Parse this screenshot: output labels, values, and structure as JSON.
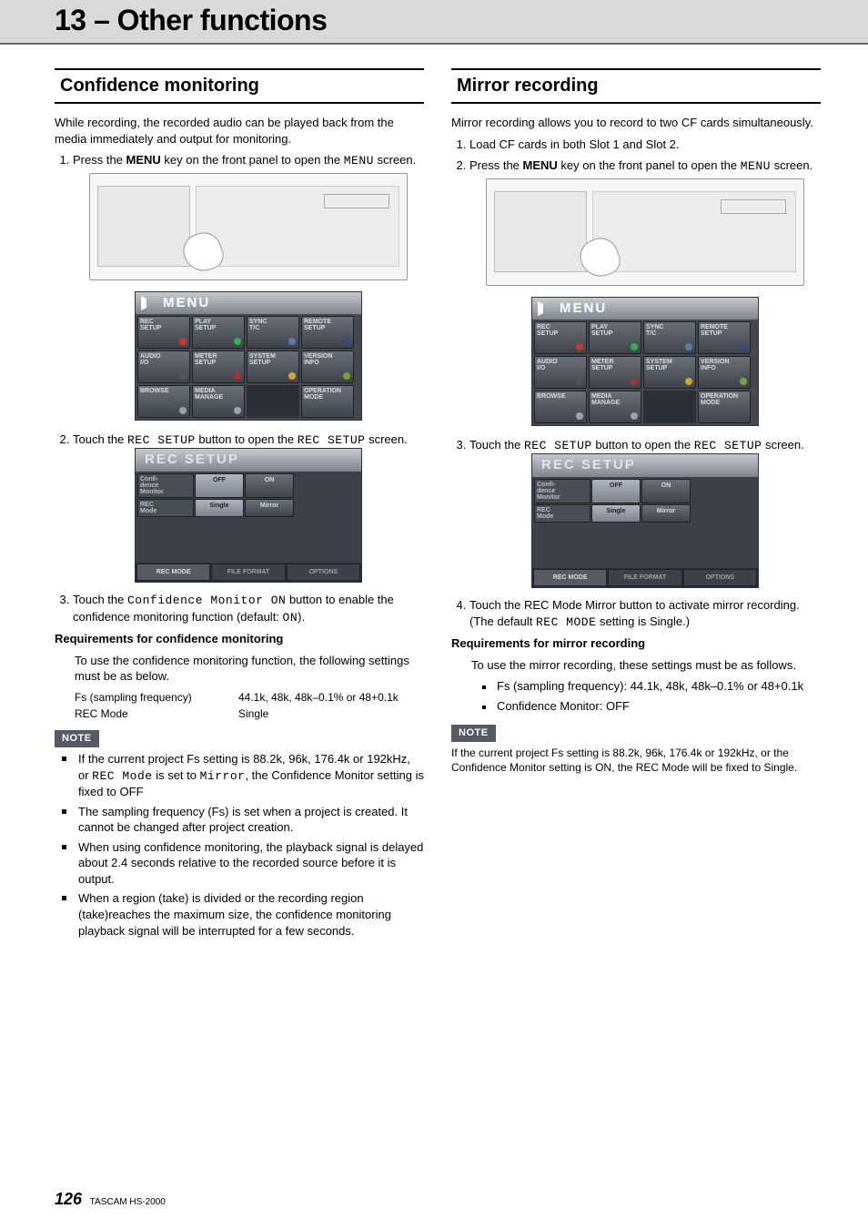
{
  "chapter_title": "13 – Other functions",
  "footer": {
    "page": "126",
    "model": "TASCAM  HS-2000"
  },
  "note_label": "NOTE",
  "menu_word": "MENU",
  "menu_items": [
    {
      "l1": "REC",
      "l2": "SETUP",
      "dot": "#c73a2f"
    },
    {
      "l1": "PLAY",
      "l2": "SETUP",
      "dot": "#2fb34e"
    },
    {
      "l1": "SYNC",
      "l2": "T/C",
      "dot": "#5a7ea8"
    },
    {
      "l1": "REMOTE",
      "l2": "SETUP",
      "dot": "#384a7a"
    },
    {
      "l1": "AUDIO",
      "l2": "I/O",
      "dot": "#555"
    },
    {
      "l1": "METER",
      "l2": "SETUP",
      "dot": "#a33"
    },
    {
      "l1": "SYSTEM",
      "l2": "SETUP",
      "dot": "#cfa534"
    },
    {
      "l1": "VERSION",
      "l2": "INFO",
      "dot": "#7fa039"
    },
    {
      "l1": "BROWSE",
      "l2": "",
      "dot": "#9aa3ac"
    },
    {
      "l1": "MEDIA",
      "l2": "MANAGE",
      "dot": "#9aa3ac"
    },
    {
      "blank": true
    },
    {
      "l1": "OPERATION",
      "l2": "MODE",
      "dot": ""
    }
  ],
  "rec_setup": {
    "title": "REC SETUP",
    "row1_label_a": "Confi-",
    "row1_label_b": "dence",
    "row1_label_c": "Monitor",
    "off": "OFF",
    "on": "ON",
    "row2_label_a": "REC",
    "row2_label_b": "Mode",
    "single": "Single",
    "mirror": "Mirror",
    "tab1": "REC MODE",
    "tab2": "FILE FORMAT",
    "tab3": "OPTIONS"
  },
  "left": {
    "heading": "Confidence monitoring",
    "intro": "While recording, the recorded audio can be played back from the media immediately and output for monitoring.",
    "step1a": "Press the ",
    "step1b": "MENU",
    "step1c": " key on the front panel to open the ",
    "step1d": "MENU",
    "step1e": " screen.",
    "step2a": "Touch the ",
    "step2b": "REC SETUP",
    "step2c": " button to open the ",
    "step2d": "REC SETUP",
    "step2e": " screen.",
    "step3a": "Touch the ",
    "step3b": "Confidence Monitor ON",
    "step3c": " button to enable the confidence monitoring function (default: ",
    "step3d": "ON",
    "step3e": ").",
    "req_head": "Requirements for confidence monitoring",
    "req_text": "To use the confidence monitoring function, the following settings must be as below.",
    "tbl1_k": "Fs (sampling frequency)",
    "tbl1_v": "44.1k, 48k, 48k–0.1% or 48+0.1k",
    "tbl2_k": "REC Mode",
    "tbl2_v": "Single",
    "notes": [
      {
        "a": "If the current project Fs setting is 88.2k, 96k, 176.4k or 192kHz, or ",
        "b": "REC Mode",
        "c": " is set to ",
        "d": "Mirror",
        "e": ", the Confidence Monitor setting is fixed to OFF"
      },
      {
        "a": "The sampling frequency (Fs) is set when a project is created. It cannot be changed after project creation."
      },
      {
        "a": "When using confidence monitoring, the playback signal is delayed about 2.4 seconds relative to the recorded source before it is output."
      },
      {
        "a": "When a region (take) is divided or the recording region (take)reaches the maximum size, the confidence monitoring playback signal will be interrupted for a few seconds."
      }
    ]
  },
  "right": {
    "heading": "Mirror recording",
    "intro": "Mirror recording allows you to record to two CF cards simultaneously.",
    "step1": "Load CF cards in both Slot 1 and Slot 2.",
    "step2a": "Press the ",
    "step2b": "MENU",
    "step2c": " key on the front panel to open the ",
    "step2d": "MENU",
    "step2e": " screen.",
    "step3a": "Touch the ",
    "step3b": "REC SETUP",
    "step3c": " button to open the ",
    "step3d": "REC SETUP",
    "step3e": " screen.",
    "step4a": "Touch the REC Mode Mirror button to activate mirror recording. (The default ",
    "step4b": "REC MODE",
    "step4c": " setting is Single.)",
    "req_head": "Requirements for mirror recording",
    "req_text": "To use the mirror recording, these settings must be as follows.",
    "req_items": [
      "Fs (sampling frequency): 44.1k, 48k, 48k–0.1% or 48+0.1k",
      "Confidence Monitor: OFF"
    ],
    "note_text": "If the current project Fs setting is 88.2k, 96k, 176.4k or 192kHz, or the Confidence Monitor setting is ON, the REC Mode will be fixed to Single."
  }
}
